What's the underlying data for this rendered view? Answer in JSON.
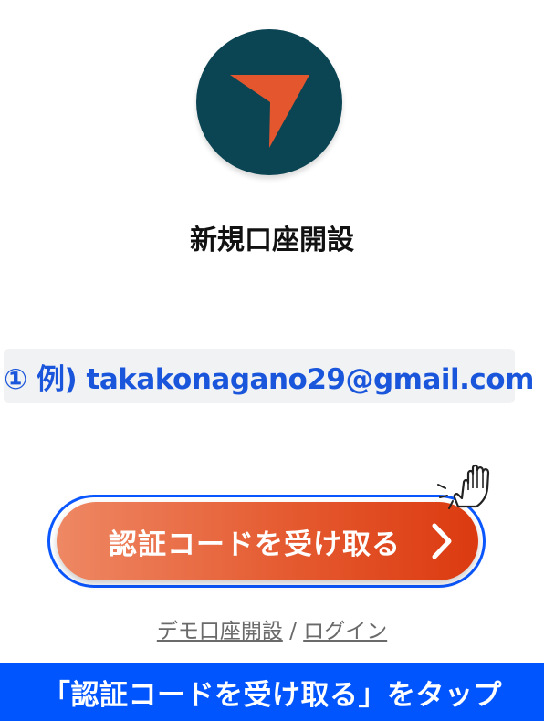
{
  "app": {
    "logo_icon": "paper-plane-arrow-logo",
    "logo_bg_color": "#0b4553",
    "logo_arrow_color": "#e4572e"
  },
  "page": {
    "title": "新規口座開設"
  },
  "email_example": {
    "text": "① 例) takakonagano29@gmail.com",
    "color": "#1a56db"
  },
  "cta": {
    "label": "認証コードを受け取る",
    "chevron_icon": "chevron-right-icon",
    "highlight_color": "#0b57ff"
  },
  "links": {
    "demo_account": "デモ口座開設",
    "separator": "/",
    "login": "ログイン"
  },
  "instruction": {
    "text": "「認証コードを受け取る」をタップ",
    "bg_color": "#0055ff"
  },
  "pointer": {
    "icon": "hand-pointer-icon"
  }
}
